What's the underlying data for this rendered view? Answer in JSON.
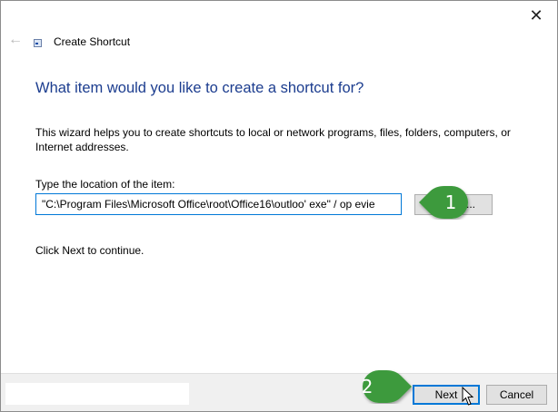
{
  "window": {
    "title": "Create Shortcut",
    "close_glyph": "✕",
    "back_glyph": "←"
  },
  "main": {
    "heading": "What item would you like to create a shortcut for?",
    "description": "This wizard helps you to create shortcuts to local or network programs, files, folders, computers, or Internet addresses.",
    "location_label": "Type the location of the item:",
    "location_value": "\"C:\\Program Files\\Microsoft Office\\root\\Office16\\outloo' exe\" / op evie",
    "browse_label": "...",
    "continue_text": "Click Next to continue."
  },
  "footer": {
    "next_label": "Next",
    "cancel_label": "Cancel"
  },
  "callouts": [
    {
      "label": "1"
    },
    {
      "label": "2"
    }
  ],
  "colors": {
    "heading": "#1c3d8f",
    "callout_green": "#3c9a3c",
    "focus_blue": "#0078d7"
  }
}
